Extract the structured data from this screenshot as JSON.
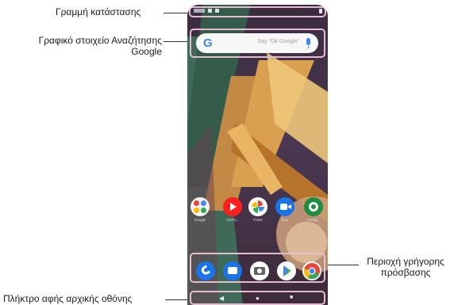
{
  "labels": {
    "status_bar": "Γραμμή κατάστασης",
    "search_widget_line1": "Γραφικό στοιχείο Αναζήτησης",
    "search_widget_line2": "Google",
    "quick_access_line1": "Περιοχή γρήγορης",
    "quick_access_line2": "πρόσβασης",
    "home_touch_key": "Πλήκτρο αφής αρχικής οθόνης"
  },
  "search": {
    "logo": "G",
    "hint": "Say \"Ok Google\""
  },
  "apps": [
    {
      "name": "Google",
      "icon": "google-folder-icon",
      "color": "#f2f2f2"
    },
    {
      "name": "YouTu...",
      "icon": "youtube-icon",
      "color": "#ff1f1f"
    },
    {
      "name": "Fotos",
      "icon": "photos-icon",
      "color": "#ffffff"
    },
    {
      "name": "Duo",
      "icon": "duo-icon",
      "color": "#1a73e8"
    },
    {
      "name": "Config...",
      "icon": "settings-icon",
      "color": "#1e8e3e"
    }
  ],
  "dock": [
    {
      "icon": "phone-icon",
      "color": "#1a73e8"
    },
    {
      "icon": "messages-icon",
      "color": "#1a73e8"
    },
    {
      "icon": "camera-icon",
      "color": "#ffffff"
    },
    {
      "icon": "play-store-icon",
      "color": "#ffffff"
    },
    {
      "icon": "chrome-icon",
      "color": "#ffffff"
    }
  ],
  "navbar": {
    "back": "◀",
    "home": "●",
    "recents": "■"
  },
  "colors": {
    "highlight": "#e8bcd0"
  }
}
